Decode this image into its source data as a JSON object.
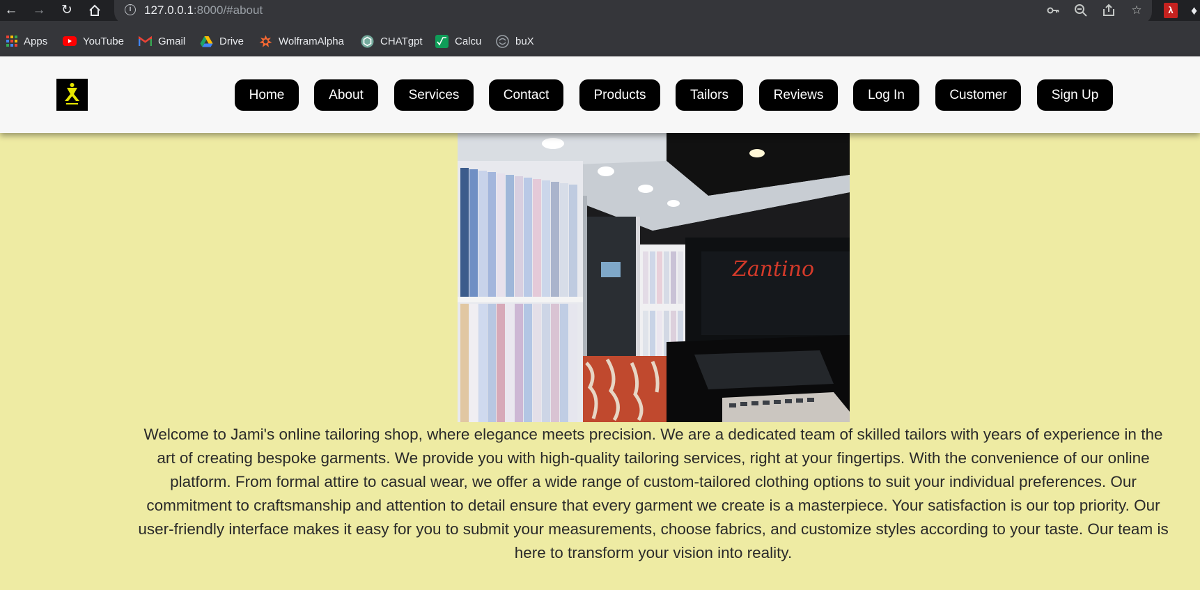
{
  "browser": {
    "url_host": "127.0.0.1",
    "url_rest": ":8000/#about",
    "toolbar_icons": [
      "back-icon",
      "forward-icon",
      "reload-icon",
      "home-icon",
      "info-icon",
      "key-icon",
      "zoom-out-icon",
      "share-icon",
      "star-icon",
      "pdf-extension-icon",
      "extensions-puzzle-icon"
    ],
    "bookmarks": [
      {
        "label": "Apps",
        "icon": "apps-grid-icon"
      },
      {
        "label": "YouTube",
        "icon": "youtube-icon",
        "color": "#ff0000"
      },
      {
        "label": "Gmail",
        "icon": "gmail-icon",
        "color": "#ea4335"
      },
      {
        "label": "Drive",
        "icon": "drive-icon",
        "color": "#1fa463"
      },
      {
        "label": "WolframAlpha",
        "icon": "wolframalpha-icon",
        "color": "#f96932"
      },
      {
        "label": "CHATgpt",
        "icon": "chatgpt-icon",
        "color": "#74aa9c"
      },
      {
        "label": "Calcu",
        "icon": "calculator-icon",
        "color": "#0f9d58"
      },
      {
        "label": "buX",
        "icon": "bux-icon",
        "color": "#9aa0a6"
      }
    ]
  },
  "site": {
    "nav": [
      "Home",
      "About",
      "Services",
      "Contact",
      "Products",
      "Tailors",
      "Reviews",
      "Log In",
      "Customer",
      "Sign Up"
    ],
    "photo_sign_text": "Zantino",
    "about_text": "Welcome to Jami's online tailoring shop, where elegance meets precision. We are a dedicated team of skilled tailors with years of experience in the art of creating bespoke garments. We provide you with high-quality tailoring services, right at your fingertips. With the convenience of our online platform. From formal attire to casual wear, we offer a wide range of custom-tailored clothing options to suit your individual preferences. Our commitment to craftsmanship and attention to detail ensure that every garment we create is a masterpiece. Your satisfaction is our top priority. Our user-friendly interface makes it easy for you to submit your measurements, choose fabrics, and customize styles according to your taste. Our team is here to transform your vision into reality."
  },
  "colors": {
    "page_background": "#eeeba3",
    "header_background": "#f7f7f7",
    "nav_button": "#000000",
    "nav_text": "#ffffff",
    "logo_accent": "#e6e600"
  }
}
